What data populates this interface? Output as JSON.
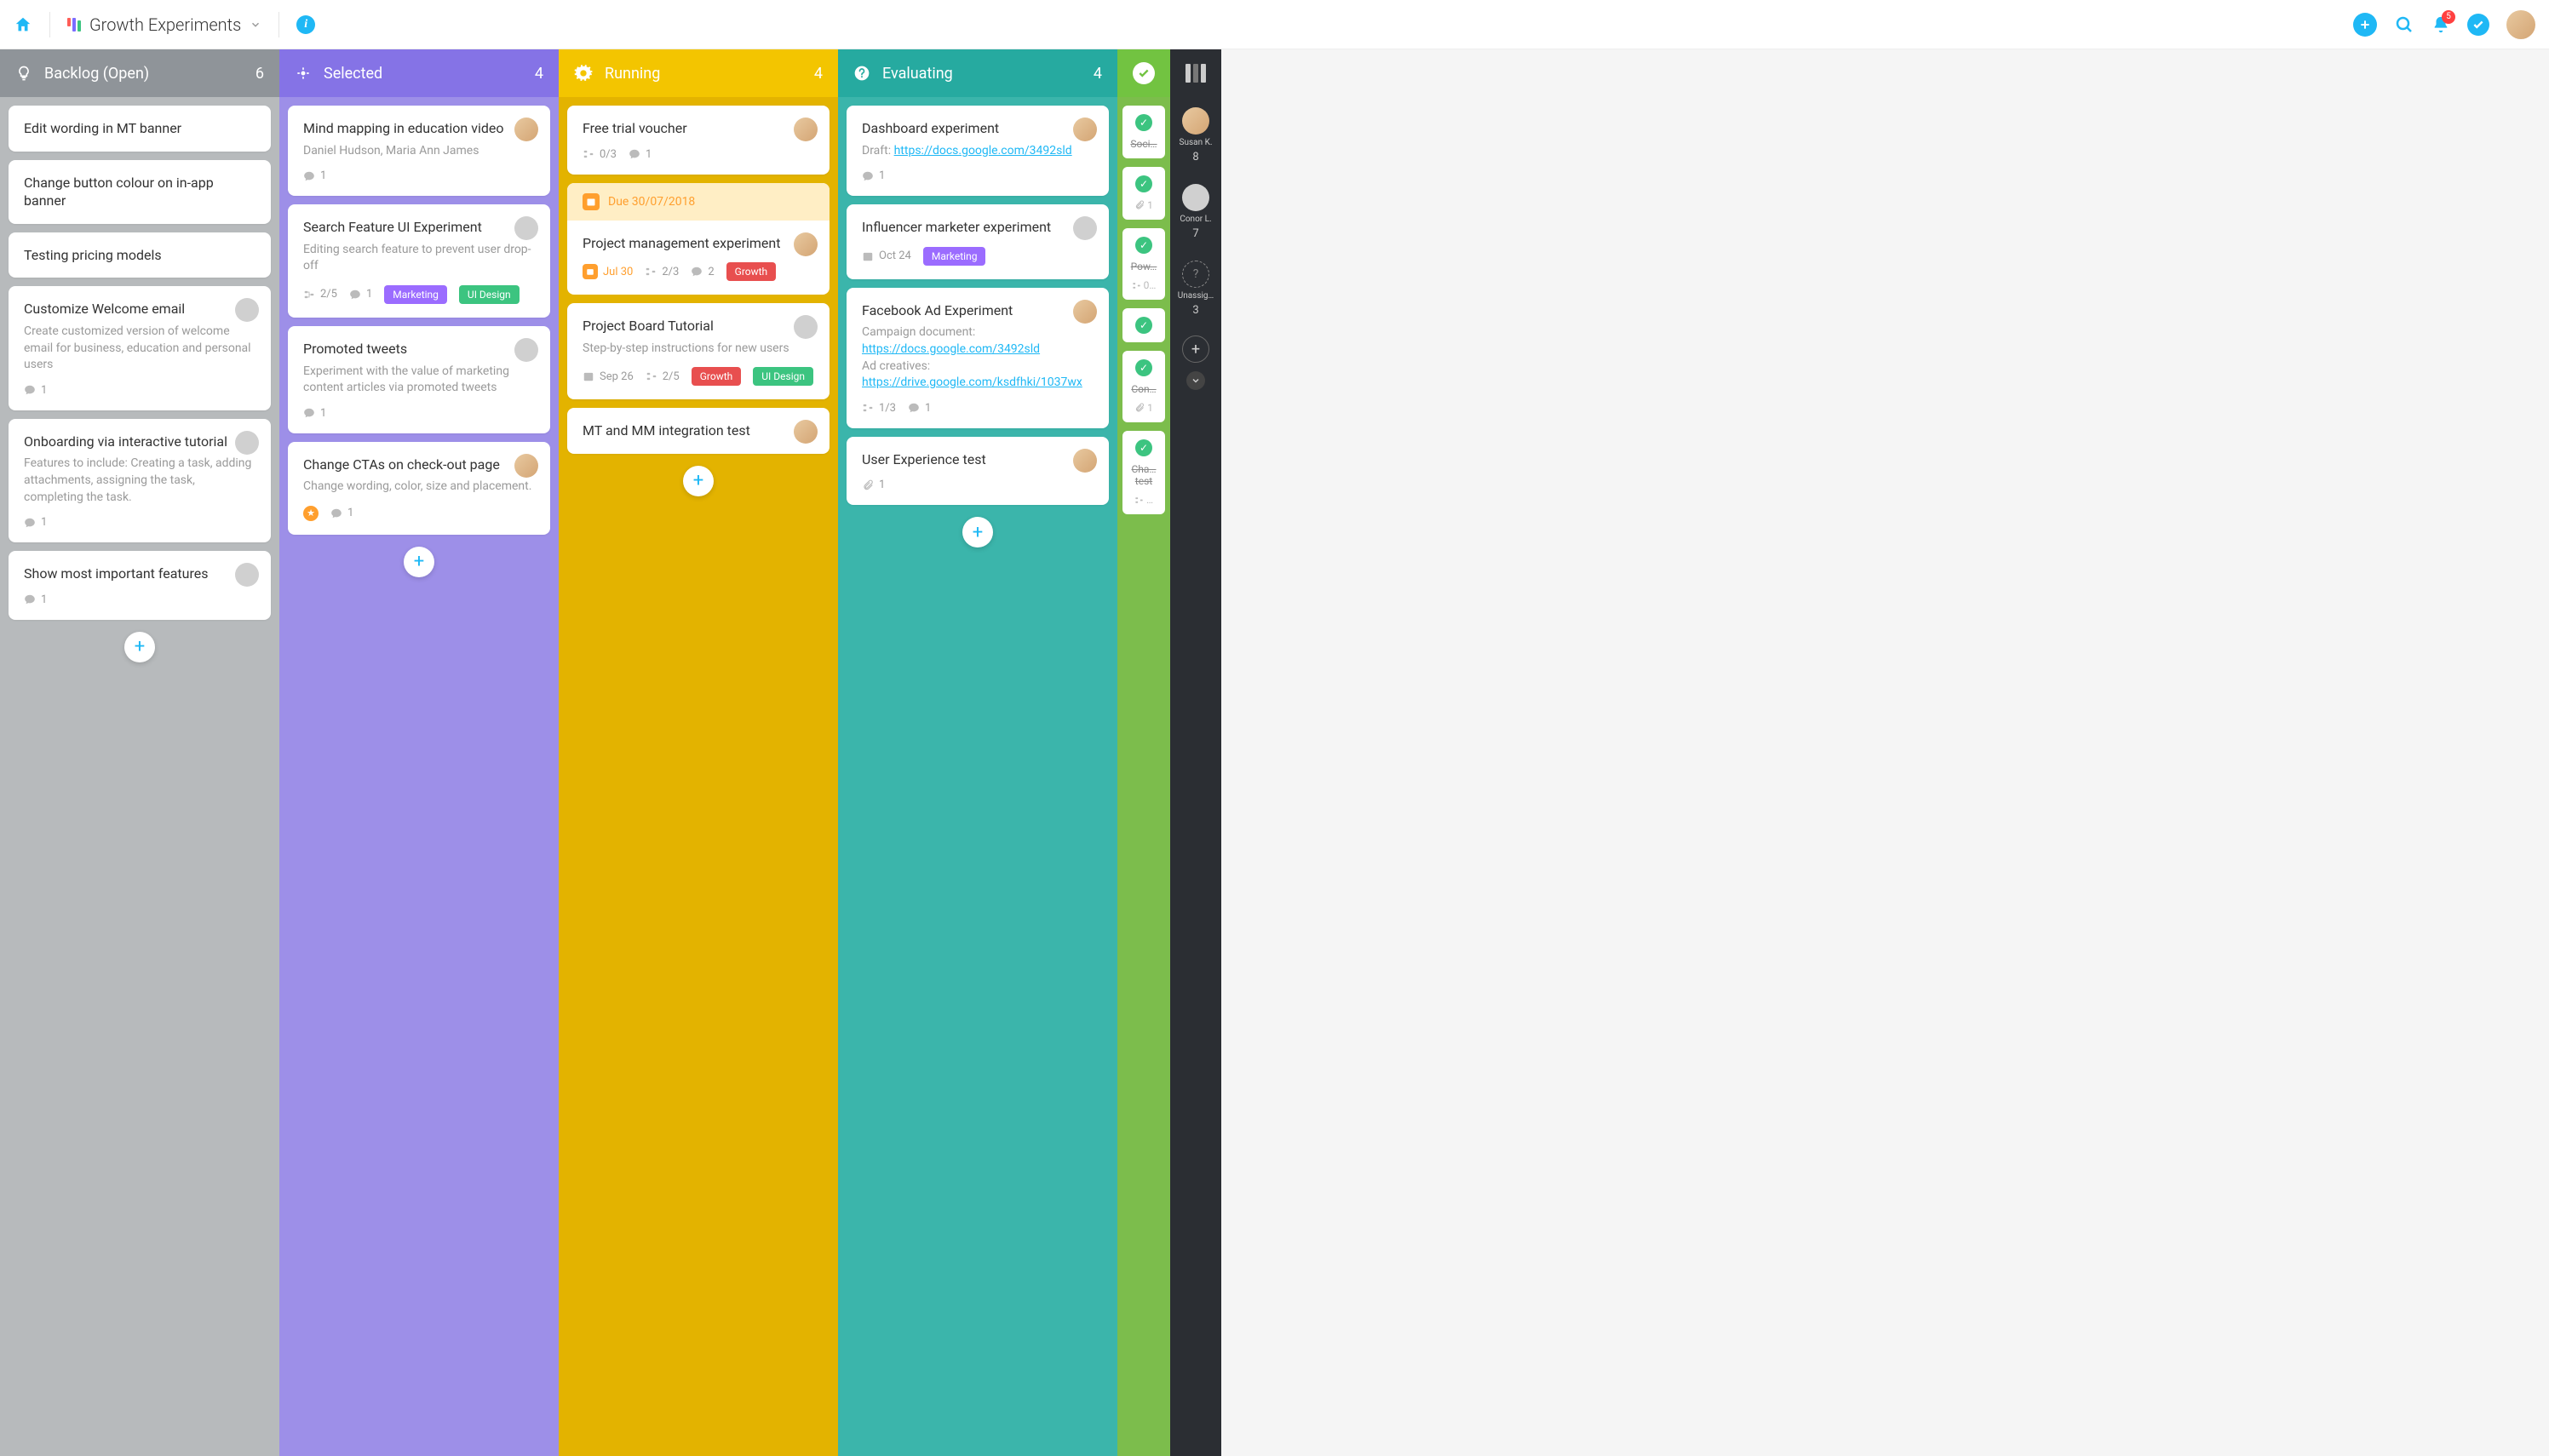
{
  "header": {
    "board_title": "Growth Experiments",
    "notifications": "5"
  },
  "columns": [
    {
      "id": "backlog",
      "title": "Backlog (Open)",
      "count": "6"
    },
    {
      "id": "selected",
      "title": "Selected",
      "count": "4"
    },
    {
      "id": "running",
      "title": "Running",
      "count": "4"
    },
    {
      "id": "evaluating",
      "title": "Evaluating",
      "count": "4"
    }
  ],
  "backlog": [
    {
      "title": "Edit wording in MT banner"
    },
    {
      "title": "Change button colour on in-app banner"
    },
    {
      "title": "Testing pricing models"
    },
    {
      "title": "Customize Welcome email",
      "desc": "Create customized version of welcome email for business, education and personal users",
      "avatar": "gray",
      "comments": "1"
    },
    {
      "title": "Onboarding via interactive tutorial",
      "desc": "Features to include: Creating a task, adding attachments, assigning the task, completing the task.",
      "avatar": "gray",
      "comments": "1"
    },
    {
      "title": "Show most important features",
      "avatar": "gray",
      "comments": "1"
    }
  ],
  "selected": [
    {
      "title": "Mind mapping in education video",
      "desc": "Daniel Hudson, Maria Ann James",
      "avatar": "photo",
      "comments": "1"
    },
    {
      "title": "Search Feature UI Experiment",
      "desc": "Editing search feature to prevent user drop-off",
      "avatar": "gray",
      "subtasks": "2/5",
      "comments": "1",
      "tags": [
        "Marketing",
        "UI Design"
      ]
    },
    {
      "title": "Promoted tweets",
      "desc": "Experiment with the value of marketing content articles via promoted tweets",
      "avatar": "gray",
      "comments": "1"
    },
    {
      "title": "Change CTAs on check-out page",
      "desc": "Change wording, color, size and placement.",
      "avatar": "photo",
      "star": true,
      "comments": "1"
    }
  ],
  "running_banner": "Due 30/07/2018",
  "running": [
    {
      "title": "Free trial voucher",
      "avatar": "photo",
      "subtasks": "0/3",
      "comments": "1"
    },
    {
      "title": "Project management experiment",
      "avatar": "photo",
      "date": "Jul 30",
      "date_orange": true,
      "subtasks": "2/3",
      "comments": "2",
      "tags": [
        "Growth"
      ]
    },
    {
      "title": "Project Board Tutorial",
      "desc": "Step-by-step instructions for new users",
      "avatar": "gray",
      "date": "Sep 26",
      "subtasks": "2/5",
      "tags": [
        "Growth",
        "UI Design"
      ]
    },
    {
      "title": "MT and MM integration test",
      "avatar": "photo"
    }
  ],
  "evaluating": [
    {
      "title": "Dashboard experiment",
      "desc_prefix": "Draft: ",
      "link": "https://docs.google.com/3492sld",
      "avatar": "photo",
      "comments": "1"
    },
    {
      "title": "Influencer marketer experiment",
      "avatar": "gray",
      "date": "Oct 24",
      "tags": [
        "Marketing"
      ]
    },
    {
      "title": "Facebook Ad Experiment",
      "desc_html": true,
      "line1": "Campaign document:",
      "link1": "https://docs.google.com/3492sld",
      "line2": "Ad creatives:",
      "link2": "https://drive.google.com/ksdfhki/1037wx",
      "avatar": "photo",
      "subtasks": "1/3",
      "comments": "1"
    },
    {
      "title": "User Experience test",
      "avatar": "photo",
      "attach": "1"
    }
  ],
  "done": [
    {
      "label": "Soci…"
    },
    {
      "label": "",
      "attach": "1"
    },
    {
      "label": "Pow…",
      "sub": "0…"
    },
    {
      "label": ""
    },
    {
      "label": "Con…",
      "attach": "1"
    },
    {
      "label": "Cha… test",
      "sub": "…"
    }
  ],
  "rightbar": {
    "users": [
      {
        "name": "Susan K.",
        "count": "8",
        "avatar": "photo"
      },
      {
        "name": "Conor L.",
        "count": "7",
        "avatar": "gray"
      },
      {
        "name": "Unassig…",
        "count": "3",
        "avatar": "dashed"
      }
    ]
  }
}
